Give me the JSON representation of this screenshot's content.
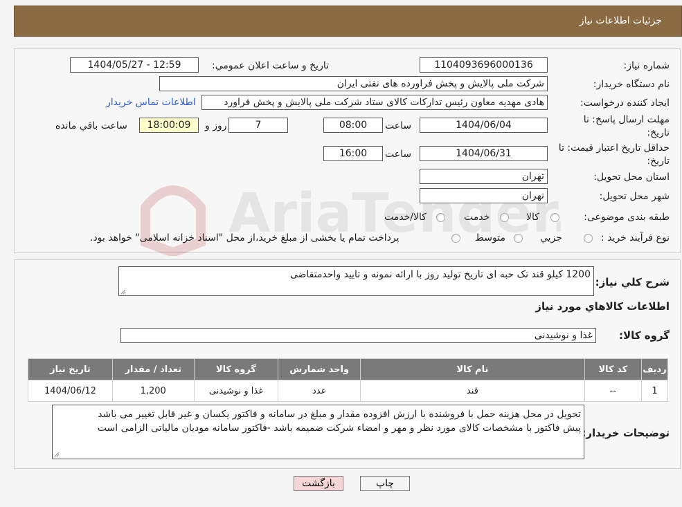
{
  "header": {
    "title": "جزئیات اطلاعات نیاز"
  },
  "fields": {
    "need_number": {
      "label": "شماره نیاز:",
      "value": "1104093696000136"
    },
    "announce_datetime": {
      "label": "تاریخ و ساعت اعلان عمومي:",
      "value": "1404/05/27 - 12:59"
    },
    "buyer_org": {
      "label": "نام دستگاه خريدار:",
      "value": "شرکت ملی پالایش و پخش فراورده های نفتی ایران"
    },
    "creator": {
      "label": "ايجاد کننده درخواست:",
      "value": "هادی مهدیه معاون رئیس تدارکات کالای ستاد شرکت ملی پالایش و پخش فراورد",
      "contact_link": "اطلاعات تماس خريدار"
    },
    "reply_deadline": {
      "label_line1": "مهلت ارسال پاسخ: تا",
      "label_line2": "تاريخ:",
      "date": "1404/06/04",
      "time_label": "ساعت",
      "time": "08:00",
      "days": "7",
      "days_label": "روز و",
      "remaining": "18:00:09",
      "remaining_label": "ساعت باقي مانده"
    },
    "price_validity": {
      "label_line1": "حداقل تاريخ اعتبار قيمت: تا",
      "label_line2": "تاريخ:",
      "date": "1404/06/31",
      "time_label": "ساعت",
      "time": "16:00"
    },
    "delivery_province": {
      "label": "استان محل تحويل:",
      "value": "تهران"
    },
    "delivery_city": {
      "label": "شهر محل تحويل:",
      "value": "تهران"
    },
    "category": {
      "label": "طبقه بندی موضوعی:",
      "options": [
        "کالا",
        "خدمت",
        "کالا/خدمت"
      ]
    },
    "purchase_type": {
      "label": "نوع فرآیند خرید :",
      "options": [
        "جزیي",
        "متوسط"
      ],
      "note": "پرداخت تمام يا بخشی از مبلغ خريد،از محل \"اسناد خزانه اسلامی\" خواهد بود."
    }
  },
  "description": {
    "label": "شرح کلي نياز:",
    "value": "1200 کیلو قند تک  حبه ای تاریخ تولید روز با ارائه نمونه و تایید واحدمتقاضی"
  },
  "goods_section_title": "اطلاعات کالاهاي مورد نياز",
  "goods_group": {
    "label": "گروه کالا:",
    "value": "غذا و نوشیدنی"
  },
  "table": {
    "headers": [
      "رديف",
      "کد کالا",
      "نام کالا",
      "واحد شمارش",
      "گروه کالا",
      "تعداد / مقدار",
      "تاريخ نياز"
    ],
    "rows": [
      [
        "1",
        "--",
        "قند",
        "عدد",
        "غذا و نوشیدنی",
        "1,200",
        "1404/06/12"
      ]
    ]
  },
  "buyer_notes": {
    "label": "توضيحات خريدار:",
    "line1": "تحویل در محل هزینه حمل با فروشنده با ارزش افزوده مقدار و مبلغ در سامانه و فاکتور یکسان و غیر قابل تغییر می باشد",
    "line2": "پیش فاکتور با مشخصات کالای مورد نظر و مهر و امضاء شرکت ضمیمه باشد -فاکتور سامانه مودیان مالیاتی الزامی است"
  },
  "buttons": {
    "print": "چاپ",
    "back": "بازگشت"
  },
  "colors": {
    "header_bg": "#8b6b43",
    "table_header_bg": "#7a7a7a",
    "back_button_bg": "#f6d6d6",
    "remaining_bg": "#ffffcc",
    "link": "#2a5bd0"
  }
}
